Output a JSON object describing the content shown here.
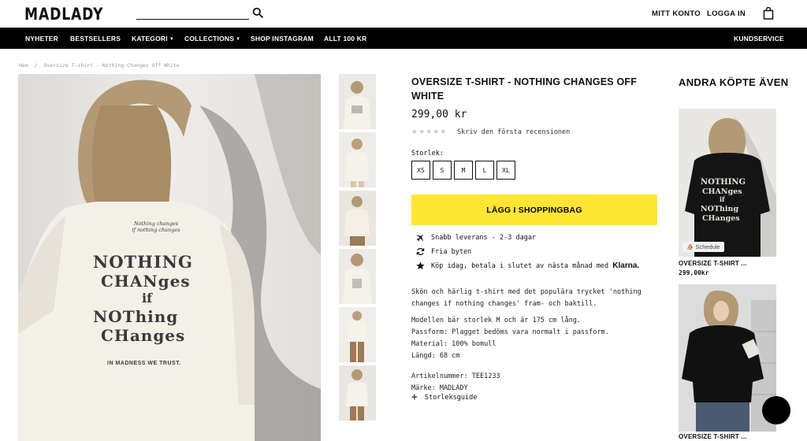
{
  "brand": "MADLADY",
  "search": {
    "placeholder": ""
  },
  "top_links": {
    "account": "MITT KONTO",
    "login": "LOGGA IN"
  },
  "nav": {
    "items": [
      "NYHETER",
      "BESTSELLERS",
      "KATEGORI",
      "COLLECTIONS",
      "SHOP INSTAGRAM",
      "ALLT 100 KR"
    ],
    "service": "KUNDSERVICE"
  },
  "breadcrumb": {
    "home": "Hem",
    "sep": "/",
    "current": "Oversize T-shirt - Nothing Changes Off White"
  },
  "product": {
    "title": "OVERSIZE T-SHIRT - NOTHING CHANGES OFF WHITE",
    "price": "299,00 kr",
    "stars": "★★★★★",
    "review_link": "Skriv den första recensionen",
    "size_label": "Storlek:",
    "sizes": [
      "XS",
      "S",
      "M",
      "L",
      "XL"
    ],
    "add_to_bag": "LÄGG I SHOPPINGBAG",
    "usps": {
      "delivery": "Snabb leverans - 2-3 dagar",
      "returns": "Fria byten",
      "klarna_text": "Köp idag, betala i slutet av nästa månad med",
      "klarna_brand": "Klarna."
    },
    "description": [
      "Skön och härlig t-shirt med det populära trycket 'nothing",
      "changes if nothing changes' fram- och baktill."
    ],
    "details": [
      "Modellen bär storlek M och är 175 cm lång.",
      "Passform: Plagget bedöms vara normalt i passform.",
      "Material: 100% bomull",
      "Längd: 68 cm"
    ],
    "meta": [
      "Artikelnummer: TEE1233",
      "Märke: MADLADY"
    ],
    "size_guide": "Storleksguide",
    "print_lines": {
      "small": [
        "Nothing changes",
        "if nothing changes"
      ],
      "big": [
        "NOTHING",
        "CHANges",
        "if",
        "NOThing",
        "CHanges"
      ],
      "footer": "IN MADNESS WE TRUST."
    }
  },
  "also_bought": {
    "title": "ANDRA KÖPTE ÄVEN",
    "items": [
      {
        "name": "OVERSIZE T-SHIRT ...",
        "price": "299,00kr",
        "badge": "Schedule"
      },
      {
        "name": "OVERSIZE T-SHIRT ..."
      }
    ]
  },
  "colors": {
    "accent": "#ffe633",
    "nav_bg": "#000000",
    "text": "#111111"
  }
}
